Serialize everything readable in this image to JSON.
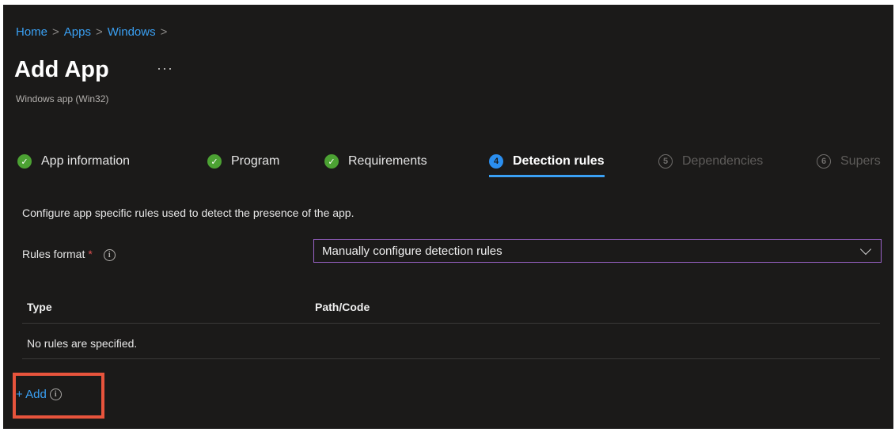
{
  "breadcrumb": {
    "items": [
      "Home",
      "Apps",
      "Windows"
    ],
    "separator": ">"
  },
  "page": {
    "title": "Add App",
    "more_icon": "···",
    "subtitle": "Windows app (Win32)"
  },
  "steps": [
    {
      "label": "App information",
      "state": "done",
      "badge": "✓"
    },
    {
      "label": "Program",
      "state": "done",
      "badge": "✓"
    },
    {
      "label": "Requirements",
      "state": "done",
      "badge": "✓"
    },
    {
      "label": "Detection rules",
      "state": "current",
      "badge": "4"
    },
    {
      "label": "Dependencies",
      "state": "todo",
      "badge": "5"
    },
    {
      "label": "Supers",
      "state": "todo",
      "badge": "6"
    }
  ],
  "main": {
    "description": "Configure app specific rules used to detect the presence of the app.",
    "rules_format_label": "Rules format",
    "required_mark": "*",
    "info_glyph": "i",
    "rules_format_value": "Manually configure detection rules"
  },
  "table": {
    "columns": [
      "Type",
      "Path/Code"
    ],
    "empty_text": "No rules are specified."
  },
  "actions": {
    "add_label": "+ Add"
  },
  "colors": {
    "background": "#1b1a19",
    "link": "#3aa0f3",
    "done": "#4ca233",
    "highlight": "#e8543c",
    "select_border": "#9b63c9"
  }
}
